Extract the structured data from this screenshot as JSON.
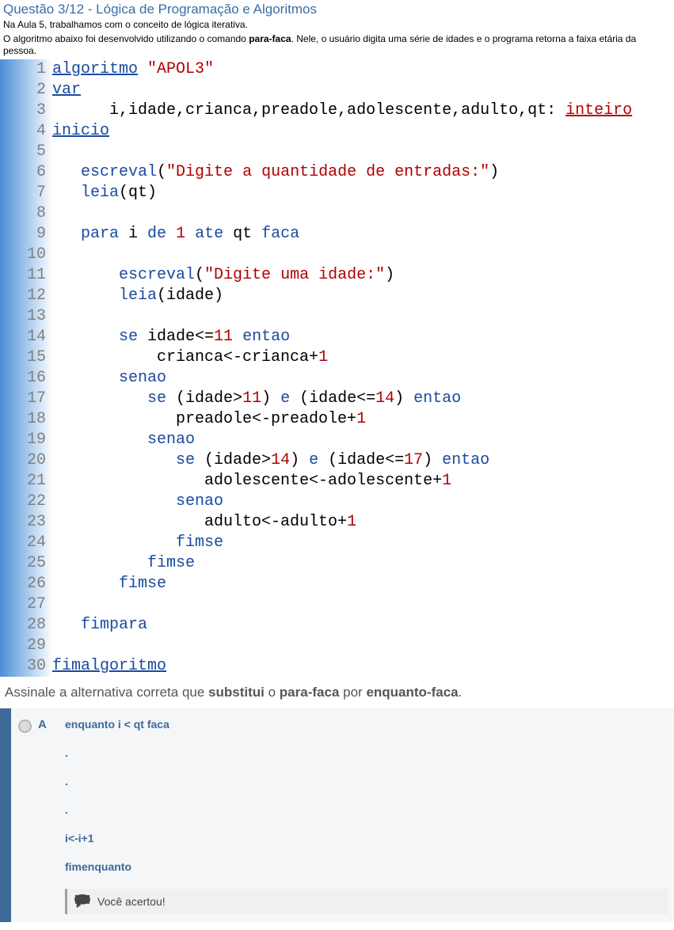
{
  "header": {
    "title": "Questão 3/12 - Lógica de Programação e Algoritmos",
    "desc_1": "Na Aula 5, trabalhamos com o conceito de lógica iterativa.",
    "desc_2a": "O algoritmo abaixo foi desenvolvido utilizando o comando ",
    "desc_2b": "para-faca",
    "desc_2c": ". Nele, o usuário digita uma série de idades e o programa retorna a faixa etária da pessoa."
  },
  "code": {
    "lines": [
      {
        "n": "1",
        "tokens": [
          {
            "c": "t-kw-u",
            "t": "algoritmo"
          },
          {
            "c": "t-def",
            "t": " "
          },
          {
            "c": "t-str",
            "t": "\"APOL3\""
          }
        ]
      },
      {
        "n": "2",
        "tokens": [
          {
            "c": "t-kw-u",
            "t": "var"
          }
        ]
      },
      {
        "n": "3",
        "tokens": [
          {
            "c": "t-def",
            "t": "      i,idade,crianca,preadole,adolescente,adulto,qt: "
          },
          {
            "c": "t-type",
            "t": "inteiro"
          }
        ]
      },
      {
        "n": "4",
        "tokens": [
          {
            "c": "t-kw-u",
            "t": "inicio"
          }
        ]
      },
      {
        "n": "5",
        "tokens": []
      },
      {
        "n": "6",
        "tokens": [
          {
            "c": "t-def",
            "t": "   "
          },
          {
            "c": "t-kw",
            "t": "escreval"
          },
          {
            "c": "t-def",
            "t": "("
          },
          {
            "c": "t-str",
            "t": "\"Digite a quantidade de entradas:\""
          },
          {
            "c": "t-def",
            "t": ")"
          }
        ]
      },
      {
        "n": "7",
        "tokens": [
          {
            "c": "t-def",
            "t": "   "
          },
          {
            "c": "t-kw",
            "t": "leia"
          },
          {
            "c": "t-def",
            "t": "(qt)"
          }
        ]
      },
      {
        "n": "8",
        "tokens": []
      },
      {
        "n": "9",
        "tokens": [
          {
            "c": "t-def",
            "t": "   "
          },
          {
            "c": "t-kw",
            "t": "para"
          },
          {
            "c": "t-def",
            "t": " i "
          },
          {
            "c": "t-kw",
            "t": "de"
          },
          {
            "c": "t-def",
            "t": " "
          },
          {
            "c": "t-num",
            "t": "1"
          },
          {
            "c": "t-def",
            "t": " "
          },
          {
            "c": "t-kw",
            "t": "ate"
          },
          {
            "c": "t-def",
            "t": " qt "
          },
          {
            "c": "t-kw",
            "t": "faca"
          }
        ]
      },
      {
        "n": "10",
        "tokens": []
      },
      {
        "n": "11",
        "tokens": [
          {
            "c": "t-def",
            "t": "       "
          },
          {
            "c": "t-kw",
            "t": "escreval"
          },
          {
            "c": "t-def",
            "t": "("
          },
          {
            "c": "t-str",
            "t": "\"Digite uma idade:\""
          },
          {
            "c": "t-def",
            "t": ")"
          }
        ]
      },
      {
        "n": "12",
        "tokens": [
          {
            "c": "t-def",
            "t": "       "
          },
          {
            "c": "t-kw",
            "t": "leia"
          },
          {
            "c": "t-def",
            "t": "(idade)"
          }
        ]
      },
      {
        "n": "13",
        "tokens": []
      },
      {
        "n": "14",
        "tokens": [
          {
            "c": "t-def",
            "t": "       "
          },
          {
            "c": "t-kw",
            "t": "se"
          },
          {
            "c": "t-def",
            "t": " idade<="
          },
          {
            "c": "t-num",
            "t": "11"
          },
          {
            "c": "t-def",
            "t": " "
          },
          {
            "c": "t-kw",
            "t": "entao"
          }
        ]
      },
      {
        "n": "15",
        "tokens": [
          {
            "c": "t-def",
            "t": "           crianca<-crianca+"
          },
          {
            "c": "t-num",
            "t": "1"
          }
        ]
      },
      {
        "n": "16",
        "tokens": [
          {
            "c": "t-def",
            "t": "       "
          },
          {
            "c": "t-kw",
            "t": "senao"
          }
        ]
      },
      {
        "n": "17",
        "tokens": [
          {
            "c": "t-def",
            "t": "          "
          },
          {
            "c": "t-kw",
            "t": "se"
          },
          {
            "c": "t-def",
            "t": " (idade>"
          },
          {
            "c": "t-num",
            "t": "11"
          },
          {
            "c": "t-def",
            "t": ") "
          },
          {
            "c": "t-kw",
            "t": "e"
          },
          {
            "c": "t-def",
            "t": " (idade<="
          },
          {
            "c": "t-num",
            "t": "14"
          },
          {
            "c": "t-def",
            "t": ") "
          },
          {
            "c": "t-kw",
            "t": "entao"
          }
        ]
      },
      {
        "n": "18",
        "tokens": [
          {
            "c": "t-def",
            "t": "             preadole<-preadole+"
          },
          {
            "c": "t-num",
            "t": "1"
          }
        ]
      },
      {
        "n": "19",
        "tokens": [
          {
            "c": "t-def",
            "t": "          "
          },
          {
            "c": "t-kw",
            "t": "senao"
          }
        ]
      },
      {
        "n": "20",
        "tokens": [
          {
            "c": "t-def",
            "t": "             "
          },
          {
            "c": "t-kw",
            "t": "se"
          },
          {
            "c": "t-def",
            "t": " (idade>"
          },
          {
            "c": "t-num",
            "t": "14"
          },
          {
            "c": "t-def",
            "t": ") "
          },
          {
            "c": "t-kw",
            "t": "e"
          },
          {
            "c": "t-def",
            "t": " (idade<="
          },
          {
            "c": "t-num",
            "t": "17"
          },
          {
            "c": "t-def",
            "t": ") "
          },
          {
            "c": "t-kw",
            "t": "entao"
          }
        ]
      },
      {
        "n": "21",
        "tokens": [
          {
            "c": "t-def",
            "t": "                adolescente<-adolescente+"
          },
          {
            "c": "t-num",
            "t": "1"
          }
        ]
      },
      {
        "n": "22",
        "tokens": [
          {
            "c": "t-def",
            "t": "             "
          },
          {
            "c": "t-kw",
            "t": "senao"
          }
        ]
      },
      {
        "n": "23",
        "tokens": [
          {
            "c": "t-def",
            "t": "                adulto<-adulto+"
          },
          {
            "c": "t-num",
            "t": "1"
          }
        ]
      },
      {
        "n": "24",
        "tokens": [
          {
            "c": "t-def",
            "t": "             "
          },
          {
            "c": "t-kw",
            "t": "fimse"
          }
        ]
      },
      {
        "n": "25",
        "tokens": [
          {
            "c": "t-def",
            "t": "          "
          },
          {
            "c": "t-kw",
            "t": "fimse"
          }
        ]
      },
      {
        "n": "26",
        "tokens": [
          {
            "c": "t-def",
            "t": "       "
          },
          {
            "c": "t-kw",
            "t": "fimse"
          }
        ]
      },
      {
        "n": "27",
        "tokens": []
      },
      {
        "n": "28",
        "tokens": [
          {
            "c": "t-def",
            "t": "   "
          },
          {
            "c": "t-kw",
            "t": "fimpara"
          }
        ]
      },
      {
        "n": "29",
        "tokens": []
      },
      {
        "n": "30",
        "tokens": [
          {
            "c": "t-kw-u",
            "t": "fimalgoritmo"
          }
        ]
      }
    ]
  },
  "prompt": {
    "pre": "Assinale a alternativa correta que ",
    "b1": "substitui",
    "mid": " o ",
    "b2": "para-faca",
    "mid2": " por ",
    "b3": "enquanto-faca",
    "post": "."
  },
  "answer": {
    "letter": "A",
    "lines": [
      "enquanto i < qt faca",
      ".",
      ".",
      ".",
      "i<-i+1",
      "fimenquanto"
    ],
    "feedback": "Você acertou!"
  }
}
